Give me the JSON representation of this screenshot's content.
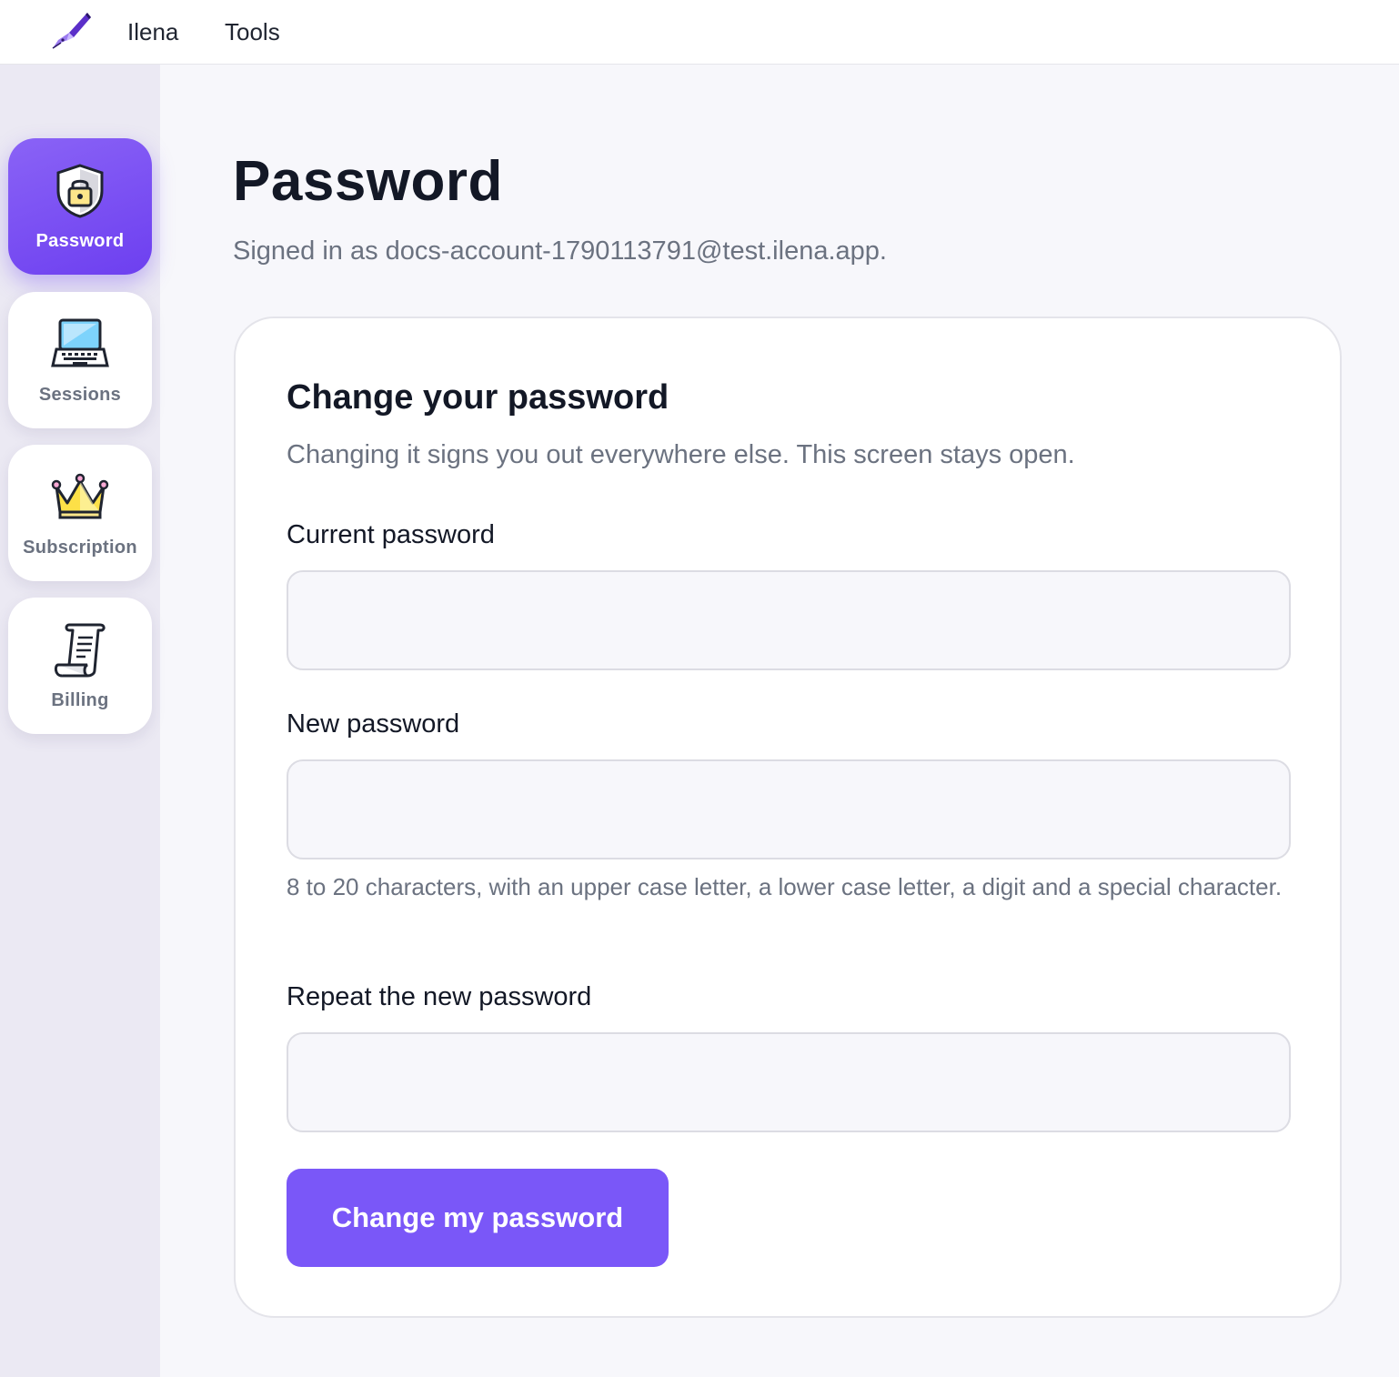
{
  "topbar": {
    "logo_icon": "fountain-pen-icon",
    "links": [
      "Ilena",
      "Tools"
    ]
  },
  "sidebar": {
    "items": [
      {
        "label": "Password",
        "icon": "shield-lock-icon",
        "active": true
      },
      {
        "label": "Sessions",
        "icon": "laptop-icon",
        "active": false
      },
      {
        "label": "Subscription",
        "icon": "crown-icon",
        "active": false
      },
      {
        "label": "Billing",
        "icon": "receipt-scroll-icon",
        "active": false
      }
    ]
  },
  "page": {
    "title": "Password",
    "signed_in": "Signed in as docs-account-1790113791@test.ilena.app."
  },
  "form": {
    "title": "Change your password",
    "subtitle": "Changing it signs you out everywhere else. This screen stays open.",
    "current_label": "Current password",
    "current_value": "",
    "new_label": "New password",
    "new_value": "",
    "new_hint": "8 to 20 characters, with an upper case letter, a lower case letter, a digit and a special character.",
    "repeat_label": "Repeat the new password",
    "repeat_value": "",
    "submit_label": "Change my password"
  },
  "colors": {
    "accent": "#7a57f8",
    "sidebar_bg": "#ebe9f3",
    "page_bg": "#f7f7fb",
    "muted_text": "#6b7280"
  }
}
